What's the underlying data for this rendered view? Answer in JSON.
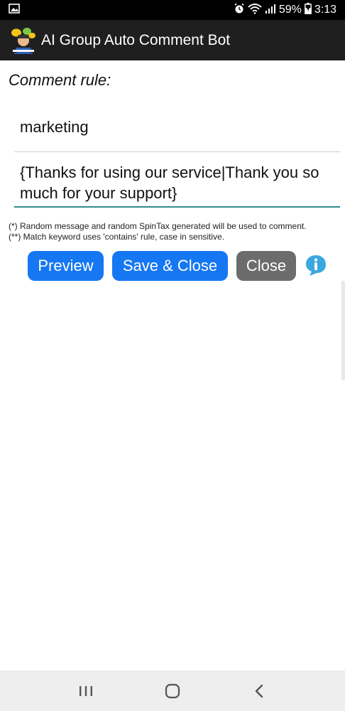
{
  "status_bar": {
    "battery": "59%",
    "time": "3:13",
    "icons": [
      "image-icon",
      "alarm-icon",
      "wifi-icon",
      "signal-icon",
      "battery-icon"
    ]
  },
  "app_bar": {
    "title": "AI Group Auto Comment Bot",
    "logo": "app-logo-icon"
  },
  "form": {
    "section_label": "Comment rule:",
    "keyword_value": "marketing",
    "message_value": "{Thanks for using our service|Thank you so much for your support}"
  },
  "notes": {
    "line1": "(*) Random message and random SpinTax generated will be used to comment.",
    "line2": "(**) Match keyword uses 'contains' rule, case in sensitive."
  },
  "actions": {
    "preview_label": "Preview",
    "save_close_label": "Save & Close",
    "close_label": "Close",
    "info_icon": "info-icon"
  },
  "colors": {
    "primary_button": "#1677f2",
    "close_button": "#6c6c6c",
    "field_focus_underline": "#2e8c8c",
    "app_bar": "#1f1f1f"
  },
  "nav_bar": {
    "icons": [
      "recent-apps-icon",
      "home-icon",
      "back-icon"
    ]
  }
}
